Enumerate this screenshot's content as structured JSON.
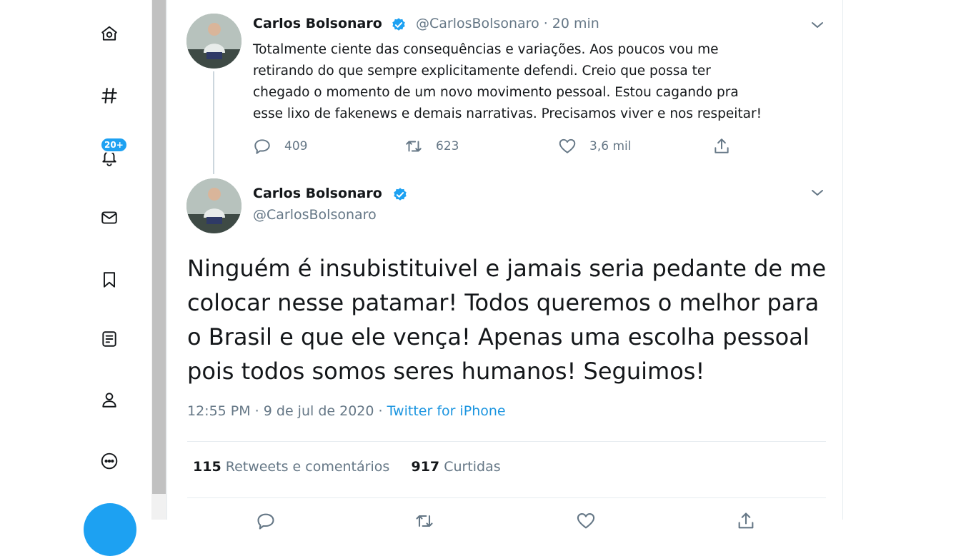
{
  "nav": {
    "notifications_badge": "20+",
    "icons": [
      "home-icon",
      "explore-hash-icon",
      "notifications-bell-icon",
      "messages-mail-icon",
      "bookmarks-icon",
      "lists-icon",
      "profile-icon",
      "more-icon"
    ]
  },
  "colors": {
    "accent": "#1da1f2",
    "text_primary": "#14171a",
    "text_secondary": "#657786",
    "link": "#1b95e0"
  },
  "parent_tweet": {
    "author_name": "Carlos Bolsonaro",
    "handle_time": "@CarlosBolsonaro · 20 min",
    "text": "Totalmente ciente das consequências e variações. Aos poucos vou me\nretirando do que sempre explicitamente defendi. Creio que possa ter\nchegado o momento de um novo movimento pessoal. Estou cagando pra\nesse lixo de fakenews e demais narrativas. Precisamos viver e nos respeitar!",
    "replies": "409",
    "retweets": "623",
    "likes": "3,6 mil"
  },
  "main_tweet": {
    "author_name": "Carlos Bolsonaro",
    "handle": "@CarlosBolsonaro",
    "text": "Ninguém é insubistituivel e jamais seria pedante de me\ncolocar nesse patamar! Todos queremos o melhor para\no Brasil e que ele vença! Apenas uma escolha pessoal\npois todos somos seres humanos! Seguimos!",
    "time_date": "12:55 PM · 9 de jul de 2020 · ",
    "source": "Twitter for iPhone",
    "retweets_count": "115",
    "retweets_label": "Retweets e comentários",
    "likes_count": "917",
    "likes_label": "Curtidas"
  }
}
